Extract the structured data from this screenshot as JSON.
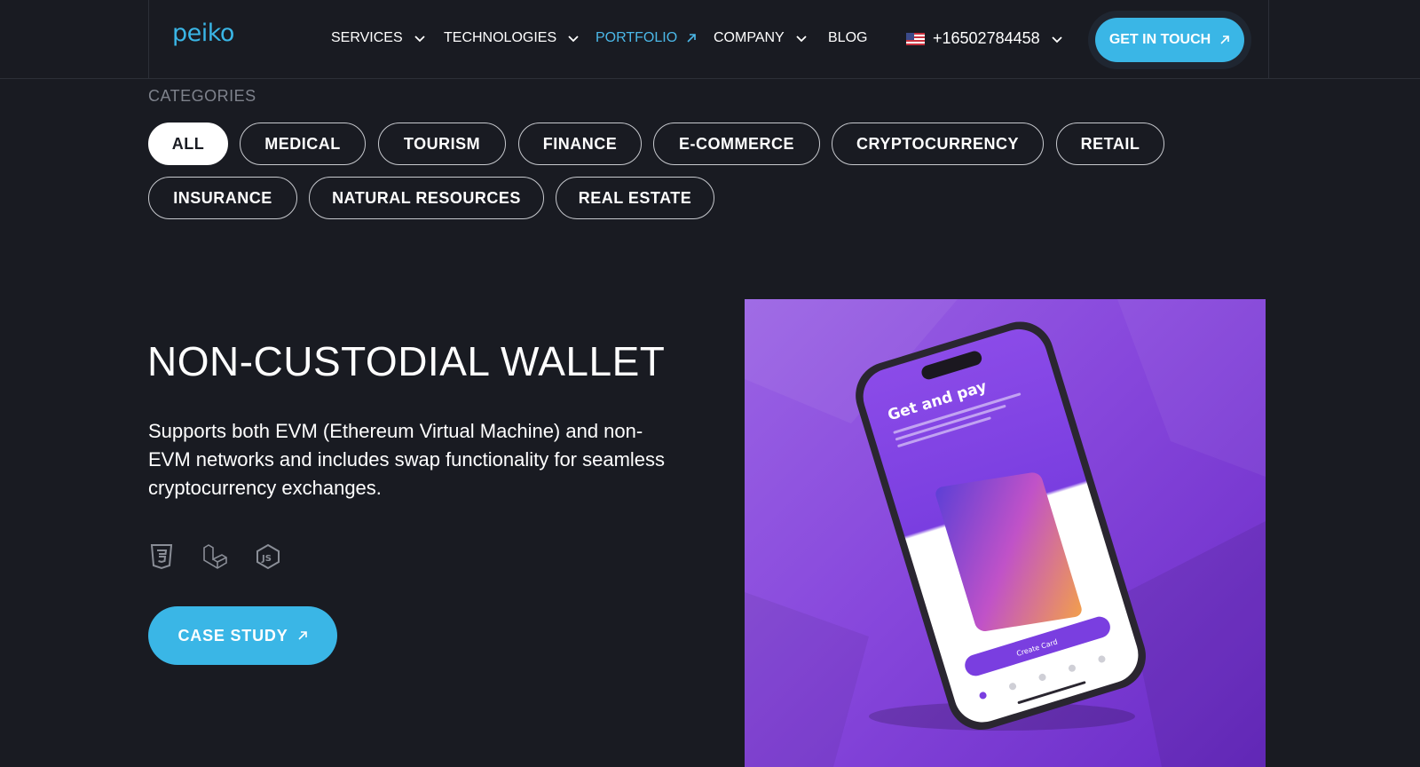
{
  "header": {
    "logo": "peiko",
    "nav": [
      {
        "label": "SERVICES",
        "dropdown": true
      },
      {
        "label": "TECHNOLOGIES",
        "dropdown": true
      },
      {
        "label": "PORTFOLIO",
        "external": true,
        "active": true
      },
      {
        "label": "COMPANY",
        "dropdown": true
      },
      {
        "label": "BLOG"
      }
    ],
    "phone": "+16502784458",
    "cta": "GET IN TOUCH"
  },
  "categories": {
    "title": "CATEGORIES",
    "items": [
      "ALL",
      "MEDICAL",
      "TOURISM",
      "FINANCE",
      "E-COMMERCE",
      "CRYPTOCURRENCY",
      "RETAIL",
      "INSURANCE",
      "NATURAL RESOURCES",
      "REAL ESTATE"
    ],
    "selected": "ALL"
  },
  "project": {
    "title": "NON-CUSTODIAL WALLET",
    "description": "Supports both EVM (Ethereum Virtual Machine) and non-EVM networks and includes swap functionality for seamless cryptocurrency exchanges.",
    "tech_icons": [
      "css3-icon",
      "laravel-icon",
      "nodejs-icon"
    ],
    "button": "CASE STUDY"
  },
  "mockup": {
    "screen_title": "Get and pay",
    "screen_button": "Create Card"
  },
  "colors": {
    "background": "#191b22",
    "accent": "#3ab6e6",
    "purple": "#8747dc"
  }
}
